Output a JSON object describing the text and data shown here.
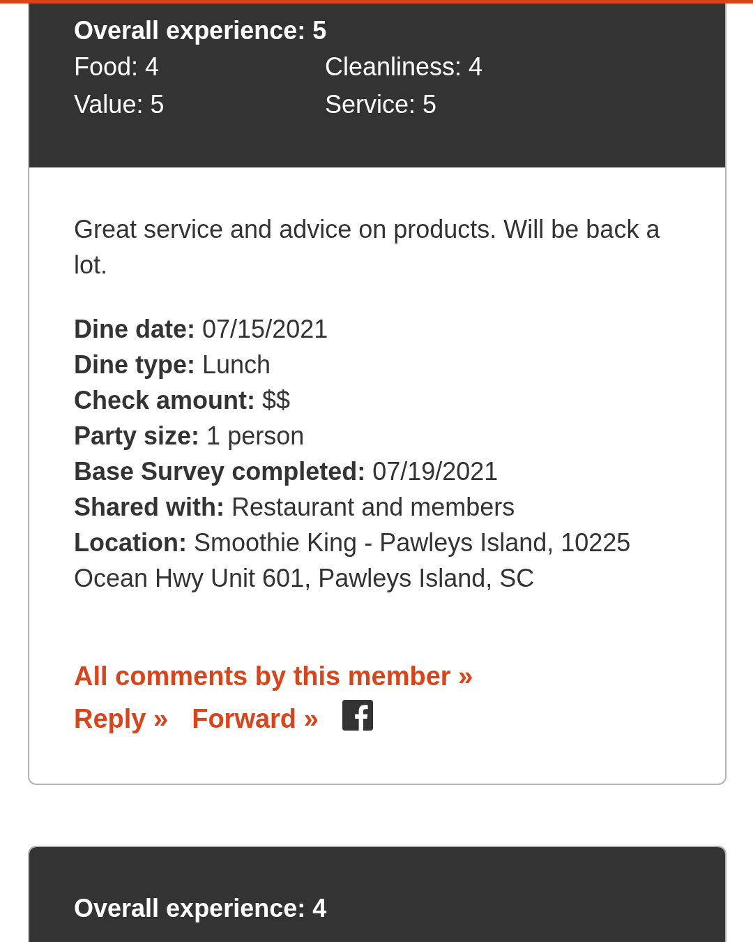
{
  "reviews": [
    {
      "overall": "Overall experience: 5",
      "ratings": [
        "Food: 4",
        "Cleanliness: 4",
        "Value: 5",
        "Service: 5"
      ],
      "comment": "Great service and advice on products. Will be back a lot.",
      "details": [
        {
          "label": "Dine date:",
          "value": "07/15/2021"
        },
        {
          "label": "Dine type:",
          "value": "Lunch"
        },
        {
          "label": "Check amount:",
          "value": "$$"
        },
        {
          "label": "Party size:",
          "value": "1 person"
        },
        {
          "label": "Base Survey completed:",
          "value": "07/19/2021"
        },
        {
          "label": "Shared with:",
          "value": "Restaurant and members"
        },
        {
          "label": "Location:",
          "value": "Smoothie King - Pawleys Island, 10225 Ocean Hwy Unit 601, Pawleys Island, SC"
        }
      ],
      "all_comments_link": "All comments by this member »",
      "actions": [
        "Reply »",
        "Forward »"
      ]
    },
    {
      "overall": "Overall experience: 4"
    }
  ]
}
